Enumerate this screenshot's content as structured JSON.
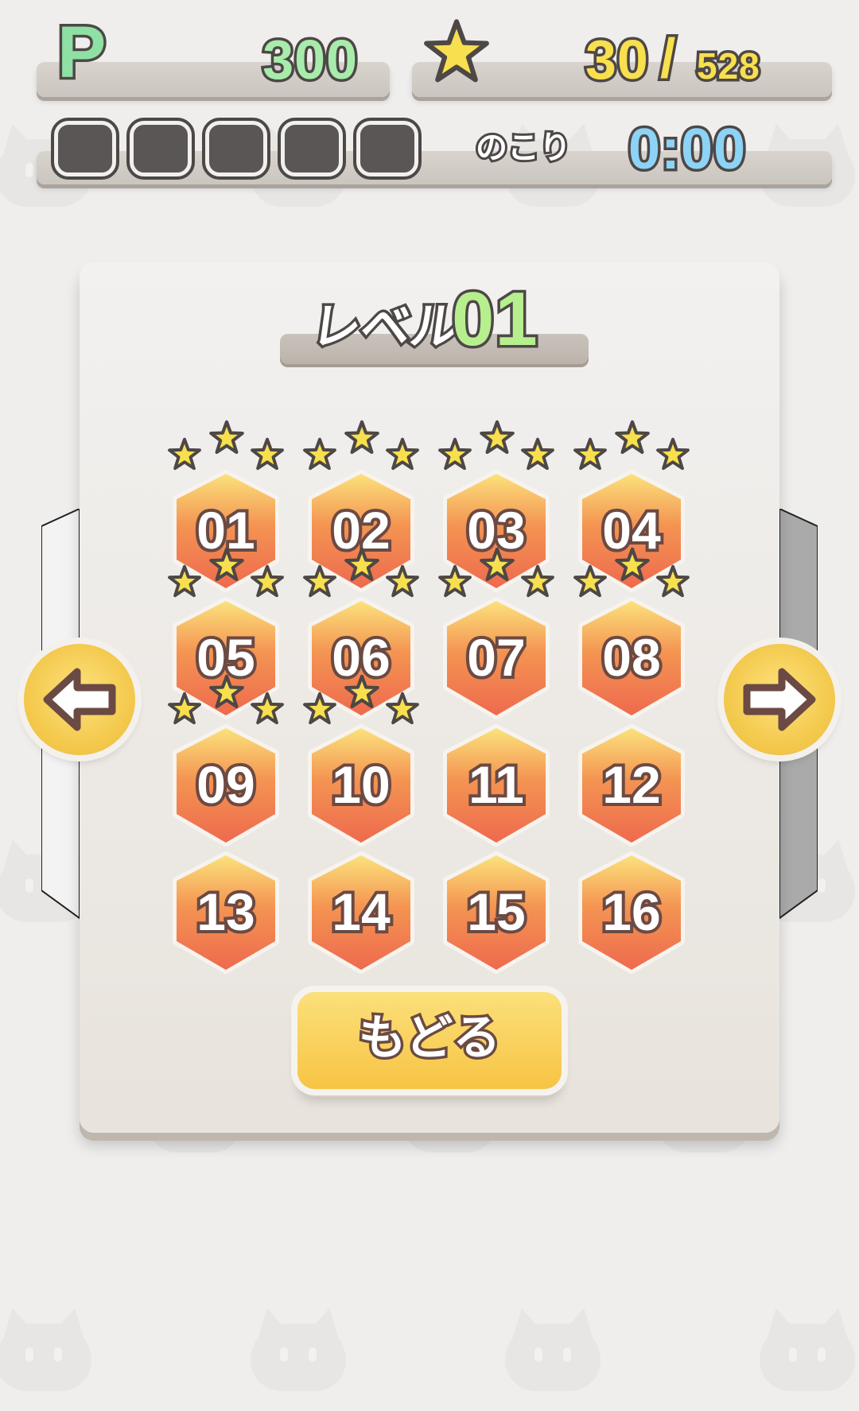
{
  "hud": {
    "points_label": "P",
    "points_value": "300",
    "stars_current": "30",
    "stars_sep": "/",
    "stars_total": "528",
    "lives_count": 5,
    "remaining_label": "のこり",
    "timer": "0:00"
  },
  "level_select": {
    "title_word": "レベル",
    "title_number": "01",
    "tiles": [
      {
        "label": "01",
        "stars": 3
      },
      {
        "label": "02",
        "stars": 3
      },
      {
        "label": "03",
        "stars": 3
      },
      {
        "label": "04",
        "stars": 3
      },
      {
        "label": "05",
        "stars": 3
      },
      {
        "label": "06",
        "stars": 3
      },
      {
        "label": "07",
        "stars": 3
      },
      {
        "label": "08",
        "stars": 3
      },
      {
        "label": "09",
        "stars": 3
      },
      {
        "label": "10",
        "stars": 3
      },
      {
        "label": "11",
        "stars": 0
      },
      {
        "label": "12",
        "stars": 0
      },
      {
        "label": "13",
        "stars": 0
      },
      {
        "label": "14",
        "stars": 0
      },
      {
        "label": "15",
        "stars": 0
      },
      {
        "label": "16",
        "stars": 0
      }
    ],
    "back_label": "もどる"
  },
  "navigation": {
    "prev_icon": "arrow-left-icon",
    "next_icon": "arrow-right-icon"
  },
  "colors": {
    "accent_yellow": "#f7c444",
    "tile_orange": "#ef6f4a",
    "points_green": "#a8ecac",
    "timer_blue": "#8cd3f6"
  }
}
